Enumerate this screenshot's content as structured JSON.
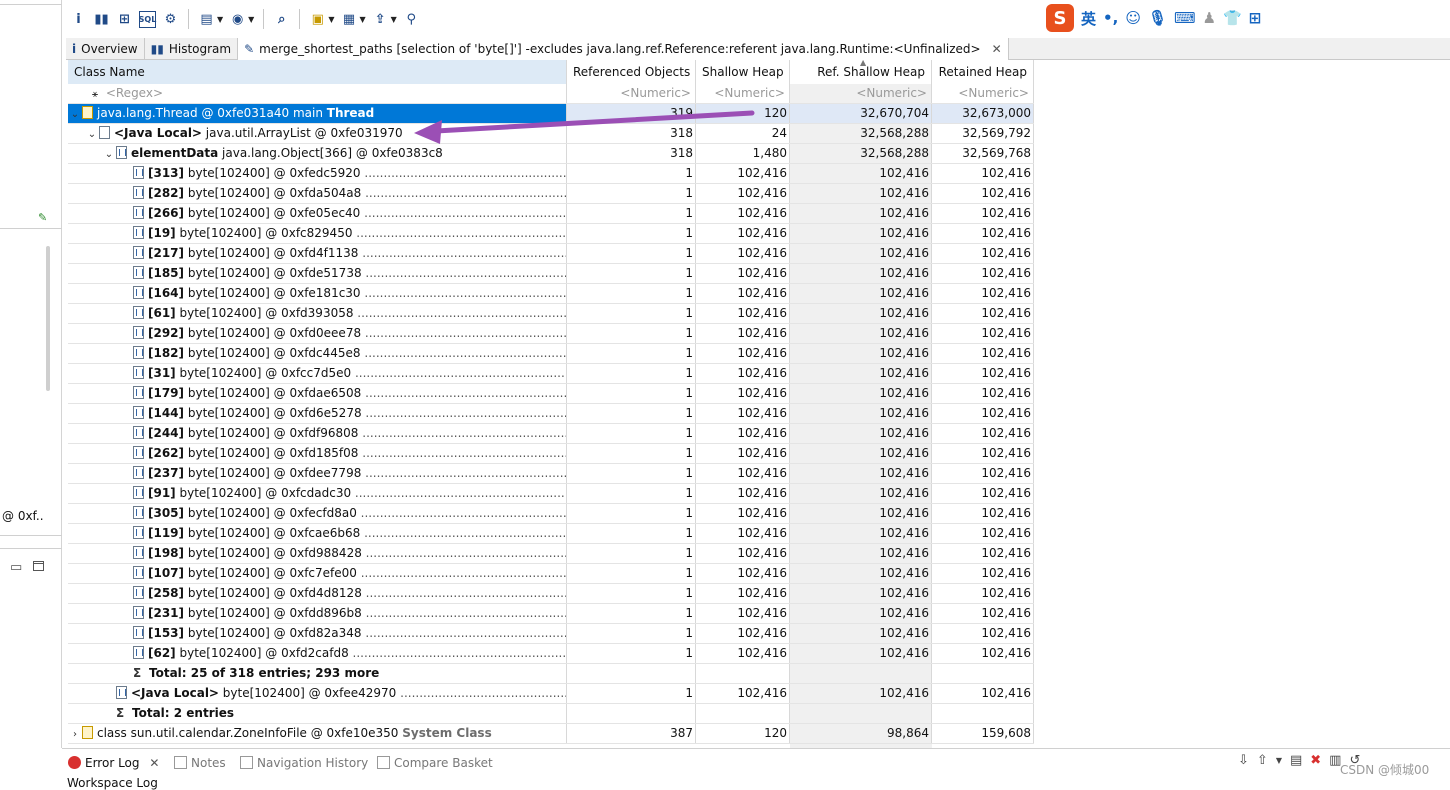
{
  "left_panel": {
    "truncated_text": "@ 0xf.."
  },
  "toolbar": {
    "icons": [
      "info-icon",
      "histogram-icon",
      "dominator-tree-icon",
      "oql-icon",
      "gear-icon",
      "run-report-icon",
      "query-browser-icon",
      "search-icon",
      "group-icon",
      "calculate-icon",
      "export-icon",
      "pin-icon"
    ]
  },
  "ime": {
    "logo": "S",
    "mode": "英",
    "punct": "•,",
    "icons": [
      "emoji-icon",
      "mic-icon",
      "keyboard-icon",
      "user-icon",
      "skin-icon",
      "grid-icon"
    ]
  },
  "tabs": [
    {
      "label": "Overview",
      "icon": "i"
    },
    {
      "label": "Histogram",
      "icon": "▮▮"
    },
    {
      "label": "merge_shortest_paths  [selection of 'byte[]'] -excludes java.lang.ref.Reference:referent java.lang.Runtime:<Unfinalized>",
      "icon": "✎",
      "active": true
    }
  ],
  "columns": {
    "name": "Class Name",
    "ref_objects": "Referenced Objects",
    "shallow": "Shallow Heap",
    "ref_shallow": "Ref. Shallow Heap",
    "retained": "Retained Heap"
  },
  "filters": {
    "name": "<Regex>",
    "numeric": "<Numeric>"
  },
  "rows": [
    {
      "indent": 0,
      "twisty": "⌄",
      "icon": "thread",
      "label": "java.lang.Thread @ 0xfe031a40  main ",
      "suffix": "Thread",
      "suffix_style": "bold",
      "ref": "319",
      "shallow": "120",
      "refshallow": "32,670,704",
      "retained": "32,673,000",
      "selected": true
    },
    {
      "indent": 1,
      "twisty": "⌄",
      "icon": "obj",
      "prefix": "<Java Local>",
      "label": " java.util.ArrayList @ 0xfe031970",
      "ref": "318",
      "shallow": "24",
      "refshallow": "32,568,288",
      "retained": "32,569,792"
    },
    {
      "indent": 2,
      "twisty": "⌄",
      "icon": "arr",
      "prefix": "elementData",
      "label": " java.lang.Object[366] @ 0xfe0383c8",
      "ref": "318",
      "shallow": "1,480",
      "refshallow": "32,568,288",
      "retained": "32,569,768"
    },
    {
      "indent": 3,
      "icon": "arr",
      "prefix": "[313]",
      "label": " byte[102400] @ 0xfedc5920",
      "dots": true,
      "ref": "1",
      "shallow": "102,416",
      "refshallow": "102,416",
      "retained": "102,416"
    },
    {
      "indent": 3,
      "icon": "arr",
      "prefix": "[282]",
      "label": " byte[102400] @ 0xfda504a8",
      "dots": true,
      "ref": "1",
      "shallow": "102,416",
      "refshallow": "102,416",
      "retained": "102,416"
    },
    {
      "indent": 3,
      "icon": "arr",
      "prefix": "[266]",
      "label": " byte[102400] @ 0xfe05ec40",
      "dots": true,
      "ref": "1",
      "shallow": "102,416",
      "refshallow": "102,416",
      "retained": "102,416"
    },
    {
      "indent": 3,
      "icon": "arr",
      "prefix": "[19]",
      "label": " byte[102400] @ 0xfc829450",
      "dots": true,
      "ref": "1",
      "shallow": "102,416",
      "refshallow": "102,416",
      "retained": "102,416"
    },
    {
      "indent": 3,
      "icon": "arr",
      "prefix": "[217]",
      "label": " byte[102400] @ 0xfd4f1138",
      "dots": true,
      "ref": "1",
      "shallow": "102,416",
      "refshallow": "102,416",
      "retained": "102,416"
    },
    {
      "indent": 3,
      "icon": "arr",
      "prefix": "[185]",
      "label": " byte[102400] @ 0xfde51738",
      "dots": true,
      "ref": "1",
      "shallow": "102,416",
      "refshallow": "102,416",
      "retained": "102,416"
    },
    {
      "indent": 3,
      "icon": "arr",
      "prefix": "[164]",
      "label": " byte[102400] @ 0xfe181c30",
      "dots": true,
      "ref": "1",
      "shallow": "102,416",
      "refshallow": "102,416",
      "retained": "102,416"
    },
    {
      "indent": 3,
      "icon": "arr",
      "prefix": "[61]",
      "label": " byte[102400] @ 0xfd393058",
      "dots": true,
      "ref": "1",
      "shallow": "102,416",
      "refshallow": "102,416",
      "retained": "102,416"
    },
    {
      "indent": 3,
      "icon": "arr",
      "prefix": "[292]",
      "label": " byte[102400] @ 0xfd0eee78",
      "dots": true,
      "ref": "1",
      "shallow": "102,416",
      "refshallow": "102,416",
      "retained": "102,416"
    },
    {
      "indent": 3,
      "icon": "arr",
      "prefix": "[182]",
      "label": " byte[102400] @ 0xfdc445e8",
      "dots": true,
      "ref": "1",
      "shallow": "102,416",
      "refshallow": "102,416",
      "retained": "102,416"
    },
    {
      "indent": 3,
      "icon": "arr",
      "prefix": "[31]",
      "label": " byte[102400] @ 0xfcc7d5e0",
      "dots": true,
      "ref": "1",
      "shallow": "102,416",
      "refshallow": "102,416",
      "retained": "102,416"
    },
    {
      "indent": 3,
      "icon": "arr",
      "prefix": "[179]",
      "label": " byte[102400] @ 0xfdae6508",
      "dots": true,
      "ref": "1",
      "shallow": "102,416",
      "refshallow": "102,416",
      "retained": "102,416"
    },
    {
      "indent": 3,
      "icon": "arr",
      "prefix": "[144]",
      "label": " byte[102400] @ 0xfd6e5278",
      "dots": true,
      "ref": "1",
      "shallow": "102,416",
      "refshallow": "102,416",
      "retained": "102,416"
    },
    {
      "indent": 3,
      "icon": "arr",
      "prefix": "[244]",
      "label": " byte[102400] @ 0xfdf96808",
      "dots": true,
      "ref": "1",
      "shallow": "102,416",
      "refshallow": "102,416",
      "retained": "102,416"
    },
    {
      "indent": 3,
      "icon": "arr",
      "prefix": "[262]",
      "label": " byte[102400] @ 0xfd185f08",
      "dots": true,
      "ref": "1",
      "shallow": "102,416",
      "refshallow": "102,416",
      "retained": "102,416"
    },
    {
      "indent": 3,
      "icon": "arr",
      "prefix": "[237]",
      "label": " byte[102400] @ 0xfdee7798",
      "dots": true,
      "ref": "1",
      "shallow": "102,416",
      "refshallow": "102,416",
      "retained": "102,416"
    },
    {
      "indent": 3,
      "icon": "arr",
      "prefix": "[91]",
      "label": " byte[102400] @ 0xfcdadc30",
      "dots": true,
      "ref": "1",
      "shallow": "102,416",
      "refshallow": "102,416",
      "retained": "102,416"
    },
    {
      "indent": 3,
      "icon": "arr",
      "prefix": "[305]",
      "label": " byte[102400] @ 0xfecfd8a0",
      "dots": true,
      "ref": "1",
      "shallow": "102,416",
      "refshallow": "102,416",
      "retained": "102,416"
    },
    {
      "indent": 3,
      "icon": "arr",
      "prefix": "[119]",
      "label": " byte[102400] @ 0xfcae6b68",
      "dots": true,
      "ref": "1",
      "shallow": "102,416",
      "refshallow": "102,416",
      "retained": "102,416"
    },
    {
      "indent": 3,
      "icon": "arr",
      "prefix": "[198]",
      "label": " byte[102400] @ 0xfd988428",
      "dots": true,
      "ref": "1",
      "shallow": "102,416",
      "refshallow": "102,416",
      "retained": "102,416"
    },
    {
      "indent": 3,
      "icon": "arr",
      "prefix": "[107]",
      "label": " byte[102400] @ 0xfc7efe00",
      "dots": true,
      "ref": "1",
      "shallow": "102,416",
      "refshallow": "102,416",
      "retained": "102,416"
    },
    {
      "indent": 3,
      "icon": "arr",
      "prefix": "[258]",
      "label": " byte[102400] @ 0xfd4d8128",
      "dots": true,
      "ref": "1",
      "shallow": "102,416",
      "refshallow": "102,416",
      "retained": "102,416"
    },
    {
      "indent": 3,
      "icon": "arr",
      "prefix": "[231]",
      "label": " byte[102400] @ 0xfdd896b8",
      "dots": true,
      "ref": "1",
      "shallow": "102,416",
      "refshallow": "102,416",
      "retained": "102,416"
    },
    {
      "indent": 3,
      "icon": "arr",
      "prefix": "[153]",
      "label": " byte[102400] @ 0xfd82a348",
      "dots": true,
      "ref": "1",
      "shallow": "102,416",
      "refshallow": "102,416",
      "retained": "102,416"
    },
    {
      "indent": 3,
      "icon": "arr",
      "prefix": "[62]",
      "label": " byte[102400] @ 0xfd2cafd8",
      "dots": true,
      "ref": "1",
      "shallow": "102,416",
      "refshallow": "102,416",
      "retained": "102,416"
    },
    {
      "indent": 3,
      "icon": "sigma",
      "prefix": "Total: 25 of 318 entries; 293 more",
      "label": "",
      "ref": "",
      "shallow": "",
      "refshallow": "",
      "retained": ""
    },
    {
      "indent": 2,
      "icon": "arr",
      "prefix": "<Java Local>",
      "label": " byte[102400] @ 0xfee42970",
      "dots": true,
      "ref": "1",
      "shallow": "102,416",
      "refshallow": "102,416",
      "retained": "102,416"
    },
    {
      "indent": 2,
      "icon": "sigma",
      "prefix": "Total: 2 entries",
      "label": "",
      "ref": "",
      "shallow": "",
      "refshallow": "",
      "retained": ""
    },
    {
      "indent": 0,
      "twisty": "›",
      "icon": "thread",
      "label": "class sun.util.calendar.ZoneInfoFile @ 0xfe10e350 ",
      "suffix": "System Class",
      "suffix_style": "gray",
      "ref": "387",
      "shallow": "120",
      "refshallow": "98,864",
      "retained": "159,608"
    }
  ],
  "bottom_tabs": [
    {
      "label": "Error Log",
      "active": true,
      "closable": true
    },
    {
      "label": "Notes"
    },
    {
      "label": "Navigation History"
    },
    {
      "label": "Compare Basket"
    }
  ],
  "workspace_log": "Workspace Log",
  "watermark": "CSDN @倾城00",
  "colors": {
    "selection": "#0078d7",
    "header_bg": "#ddeaf6",
    "arrow": "#9b4fb5",
    "ime_logo": "#e8501d"
  }
}
